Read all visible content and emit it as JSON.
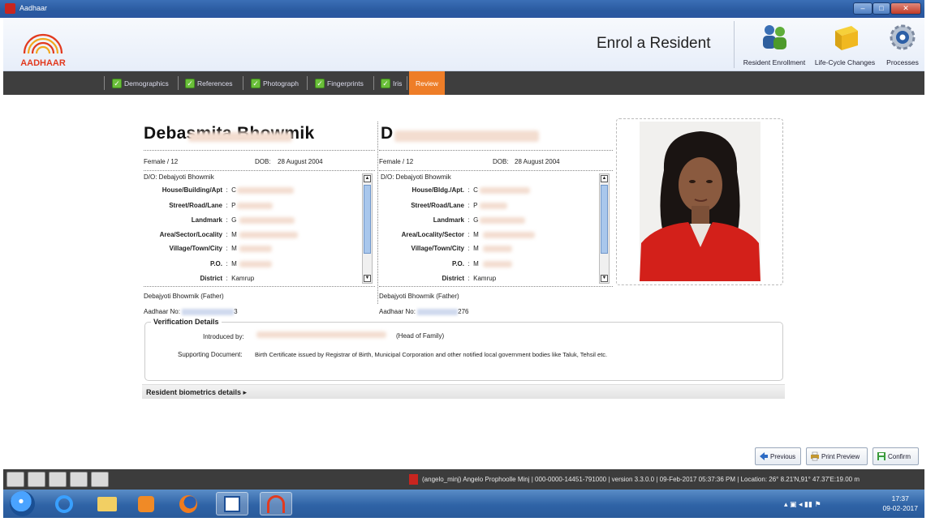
{
  "window": {
    "title": "Aadhaar",
    "min_label": "–",
    "max_label": "□",
    "close_label": "✕"
  },
  "header": {
    "logo_text": "AADHAAR",
    "heading": "Enrol a Resident",
    "processes": [
      {
        "label": "Resident Enrollment",
        "icon": "people-icon"
      },
      {
        "label": "Life-Cycle Changes",
        "icon": "box-icon"
      },
      {
        "label": "Processes",
        "icon": "gear-icon"
      }
    ]
  },
  "tabs": [
    {
      "label": "Demographics",
      "checked": true
    },
    {
      "label": "References",
      "checked": true
    },
    {
      "label": "Photograph",
      "checked": true
    },
    {
      "label": "Fingerprints",
      "checked": true
    },
    {
      "label": "Iris",
      "checked": true
    },
    {
      "label": "Review",
      "active": true
    }
  ],
  "resident": {
    "name_left": "Debasmita Bhowmik",
    "name_right": "D",
    "gender_age": "Female / 12",
    "dob_label": "DOB:",
    "dob_value": "28 August 2004",
    "relation": "D/O: Debajyoti Bhowmik",
    "relation_right": "D/O: Debajyoti Bhowmik",
    "address_left": [
      {
        "label": "House/Building/Apt",
        "value": "C"
      },
      {
        "label": "Street/Road/Lane",
        "value": "P"
      },
      {
        "label": "Landmark",
        "value": "G"
      },
      {
        "label": "Area/Sector/Locality",
        "value": "M"
      },
      {
        "label": "Village/Town/City",
        "value": "M"
      },
      {
        "label": "P.O.",
        "value": "M"
      },
      {
        "label": "District",
        "value": "Kamrup"
      }
    ],
    "address_right": [
      {
        "label": "House/Bldg./Apt.",
        "value": "C"
      },
      {
        "label": "Street/Road/Lane",
        "value": "P"
      },
      {
        "label": "Landmark",
        "value": "G"
      },
      {
        "label": "Area/Locality/Sector",
        "value": "M"
      },
      {
        "label": "Village/Town/City",
        "value": "M"
      },
      {
        "label": "P.O.",
        "value": "M"
      },
      {
        "label": "District",
        "value": "Kamrup"
      }
    ],
    "father": "Debajyoti Bhowmik (Father)",
    "aadhaar_label": "Aadhaar No:",
    "aadhaar_left_suffix": "3",
    "aadhaar_right_suffix": "276"
  },
  "verification": {
    "title": "Verification Details",
    "introduced_label": "Introduced by:",
    "introduced_value": "(Head of Family)",
    "supporting_label": "Supporting Document:",
    "supporting_value": "Birth Certificate issued by Registrar of Birth, Municipal Corporation and other notified local government bodies like Taluk, Tehsil etc."
  },
  "biometrics_label": "Resident biometrics details ▸",
  "actions": {
    "previous": "Previous",
    "print_preview": "Print Preview",
    "confirm": "Confirm"
  },
  "status": {
    "text": "(angelo_minj) Angelo Prophoolle Minj | 000-0000-14451-791000 | version 3.3.0.0 | 09-Feb-2017 05:37:36 PM | Location: 26° 8.21'N,91° 47.37'E:19.00 m"
  },
  "clock": {
    "time": "17:37",
    "date": "09-02-2017"
  },
  "colors": {
    "accent_tab": "#ee7d27",
    "check_green": "#6bbf3a",
    "tab_bg": "#3e3e3e"
  }
}
